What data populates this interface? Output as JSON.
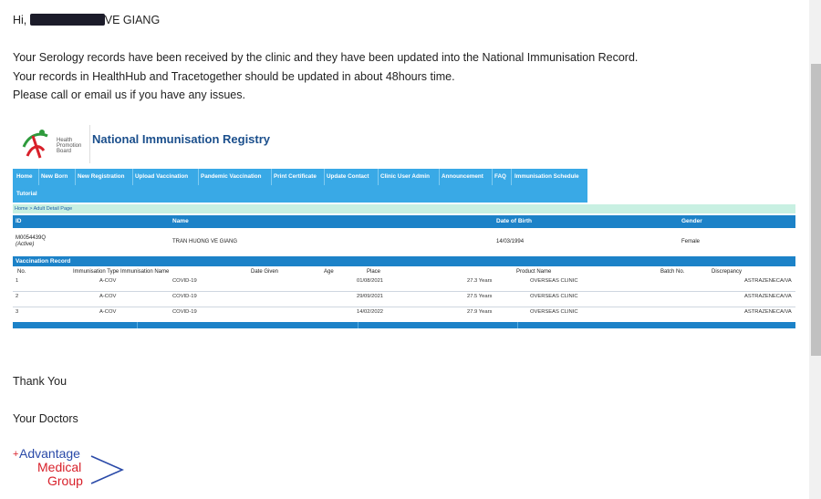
{
  "email": {
    "greeting_prefix": "Hi, ",
    "greeting_suffix": "VE GIANG",
    "lines": [
      "Your Serology records have been received by the clinic and they have been updated into the National Immunisation Record.",
      "Your records in HealthHub and Tracetogether should be updated in about 48hours time.",
      "Please call or email us if you have any issues."
    ],
    "thanks": "Thank You",
    "signoff": "Your Doctors"
  },
  "nir": {
    "logo_text": [
      "Health",
      "Promotion",
      "Board"
    ],
    "title": "National Immunisation Registry",
    "nav": [
      "Home",
      "New Born",
      "New Registration",
      "Upload Vaccination",
      "Pandemic Vaccination",
      "Print Certificate",
      "Update Contact",
      "Clinic User Admin",
      "Announcement",
      "FAQ",
      "Immunisation Schedule",
      "Tutorial"
    ],
    "breadcrumb": "Home > Adult Detail Page",
    "patient_headers": [
      "ID",
      "Name",
      "Date of Birth",
      "Gender"
    ],
    "patient": {
      "id": "M0054439Q",
      "status": "(Active)",
      "name": "TRAN HUONG VE GIANG",
      "dob": "14/03/1994",
      "gender": "Female"
    },
    "vaccination_title": "Vaccination Record",
    "vacc_headers": [
      "No.",
      "Immunisation Type",
      "Immunisation Name",
      "Date Given",
      "Age",
      "Place",
      "Product Name",
      "Batch No.",
      "Discrepancy"
    ],
    "records": [
      {
        "no": "1",
        "type": "A-COV",
        "name": "COVID-19",
        "date": "01/08/2021",
        "age": "27.3 Years",
        "place": "OVERSEAS CLINIC",
        "product": "ASTRAZENECA/VA"
      },
      {
        "no": "2",
        "type": "A-COV",
        "name": "COVID-19",
        "date": "29/09/2021",
        "age": "27.5 Years",
        "place": "OVERSEAS CLINIC",
        "product": "ASTRAZENECA/VA"
      },
      {
        "no": "3",
        "type": "A-COV",
        "name": "COVID-19",
        "date": "14/02/2022",
        "age": "27.9 Years",
        "place": "OVERSEAS CLINIC",
        "product": "ASTRAZENECA/VA"
      }
    ]
  },
  "signature_logo": {
    "plus": "+",
    "line1": "Advantage",
    "line2": "Medical",
    "line3": "Group"
  },
  "colors": {
    "nav_blue": "#39a9e6",
    "table_blue": "#1c82c8",
    "title_blue": "#1b4f8c",
    "amg_blue": "#2a4aa8",
    "amg_red": "#d8202a"
  }
}
